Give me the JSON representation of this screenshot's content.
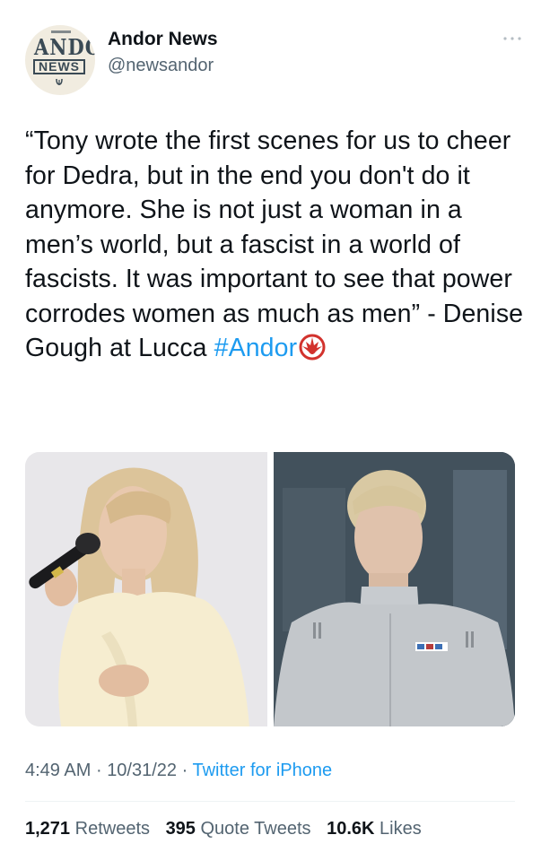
{
  "account": {
    "name": "Andor News",
    "handle": "@newsandor",
    "avatar_logo_text": [
      "ANDOR",
      "NEWS"
    ]
  },
  "tweet": {
    "text_parts": [
      "“Tony wrote the first scenes for us to cheer for Dedra, but in the end you don't do it anymore. She is not just a woman in a men’s world, but a fascist in a world of fascists. It was important to see that power corrodes women as much as men” - Denise Gough at Lucca ",
      "#Andor"
    ],
    "emoji": "rebel-alliance-icon"
  },
  "media": {
    "left_photo": "woman-speaking-into-microphone-photo",
    "right_photo": "imperial-officer-uniform-photo"
  },
  "meta": {
    "time": "4:49 AM",
    "date": "10/31/22",
    "separator": "·",
    "source": "Twitter for iPhone"
  },
  "stats": {
    "retweets_count": "1,271",
    "retweets_label": "Retweets",
    "quotes_count": "395",
    "quotes_label": "Quote Tweets",
    "likes_count": "10.6K",
    "likes_label": "Likes"
  },
  "colors": {
    "link": "#1d9bf0",
    "secondary_text": "#536471",
    "primary_text": "#0f1419",
    "emoji_red": "#d2322d"
  }
}
